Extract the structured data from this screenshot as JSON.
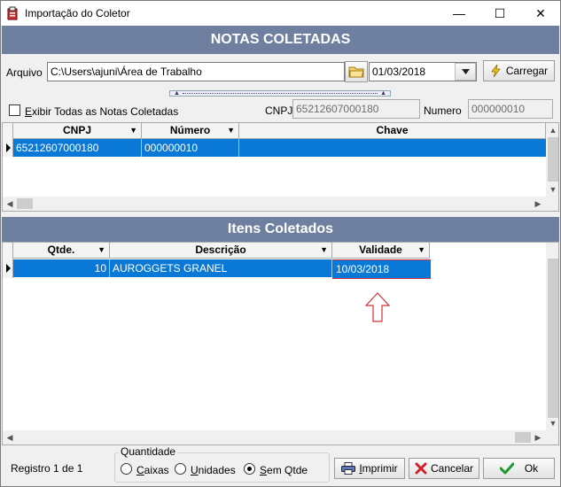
{
  "window": {
    "title": "Importação do Coletor",
    "minimize_glyph": "—",
    "maximize_glyph": "☐",
    "close_glyph": "✕"
  },
  "header": {
    "title": "NOTAS COLETADAS"
  },
  "file_row": {
    "label": "Arquivo",
    "path": "C:\\Users\\ajuni\\Área de Trabalho",
    "date": "01/03/2018",
    "load_button": "Carregar"
  },
  "filters": {
    "show_all_label_underlined": "E",
    "show_all_label_rest": "xibir Todas as Notas Coletadas",
    "show_all_checked": false,
    "cnpj_label": "CNPJ",
    "cnpj_value": "65212607000180",
    "numero_label": "Numero",
    "numero_value": "000000010"
  },
  "notes_grid": {
    "columns": [
      "CNPJ",
      "Número",
      "Chave"
    ],
    "rows": [
      {
        "cnpj": "65212607000180",
        "numero": "000000010",
        "chave": ""
      }
    ]
  },
  "items_section": {
    "title": "Itens Coletados"
  },
  "items_grid": {
    "columns": [
      "Qtde.",
      "Descrição",
      "Validade"
    ],
    "rows": [
      {
        "qtde": "10",
        "descricao": "AUROGGETS GRANEL",
        "validade": "10/03/2018"
      }
    ]
  },
  "footer": {
    "record_status": "Registro 1 de 1",
    "quantity_group": "Quantidade",
    "options": [
      {
        "underlined": "C",
        "rest": "aixas",
        "checked": false
      },
      {
        "underlined": "U",
        "rest": "nidades",
        "checked": false
      },
      {
        "underlined": "S",
        "rest": "em Qtde",
        "checked": true
      }
    ],
    "print_button_underlined": "I",
    "print_button_rest": "mprimir",
    "cancel_button": "Cancelar",
    "ok_button": "Ok"
  },
  "colors": {
    "header_bg": "#6f7f9f",
    "selection": "#0a78d7",
    "annotation_arrow": "#d0303b"
  }
}
